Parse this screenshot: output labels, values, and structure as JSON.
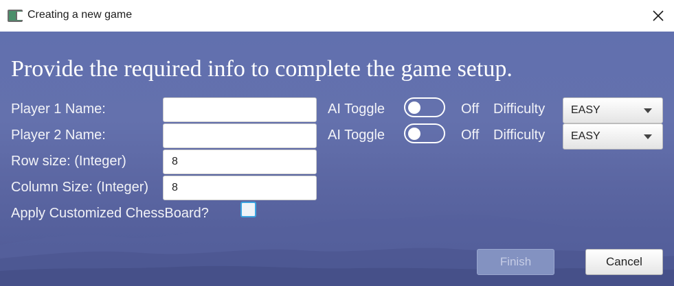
{
  "window": {
    "title": "Creating a new game",
    "app_icon": "app-window-icon",
    "close_icon": "close-icon"
  },
  "form": {
    "heading": "Provide the required info to complete the game setup.",
    "player1": {
      "label": "Player 1 Name:",
      "value": "",
      "ai_toggle_label": "AI Toggle",
      "ai_toggle_state": "Off",
      "difficulty_label": "Difficulty",
      "difficulty_value": "EASY"
    },
    "player2": {
      "label": "Player 2 Name:",
      "value": "",
      "ai_toggle_label": "AI Toggle",
      "ai_toggle_state": "Off",
      "difficulty_label": "Difficulty",
      "difficulty_value": "EASY"
    },
    "row_size": {
      "label": "Row size: (Integer)",
      "value": "8"
    },
    "column_size": {
      "label": "Column Size: (Integer)",
      "value": "8"
    },
    "custom_board": {
      "label": "Apply Customized ChessBoard?",
      "checked": false
    }
  },
  "buttons": {
    "finish": "Finish",
    "cancel": "Cancel"
  }
}
